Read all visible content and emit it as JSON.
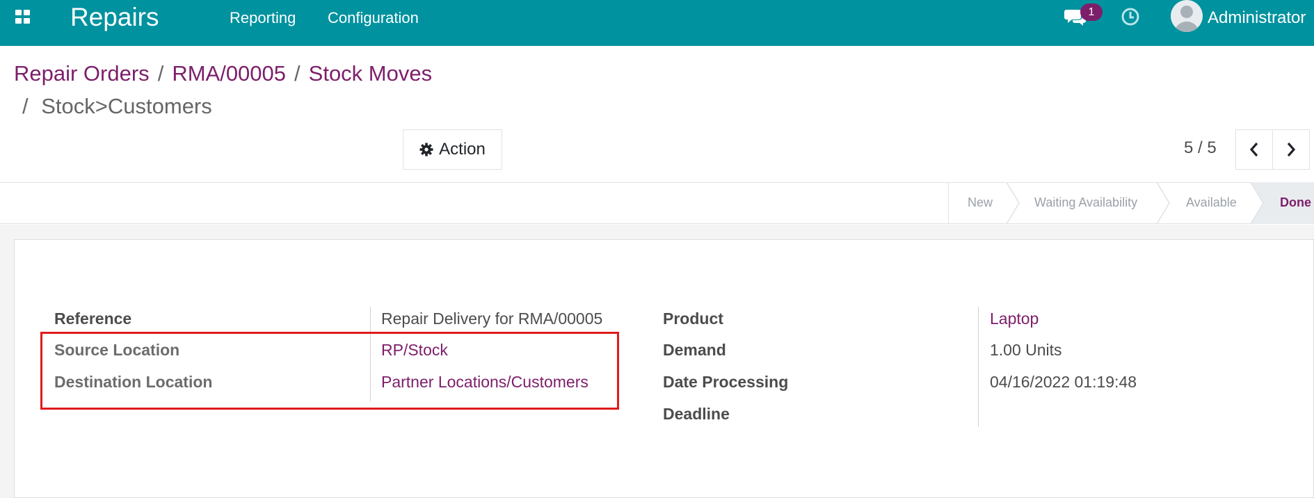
{
  "navbar": {
    "app_title": "Repairs",
    "menu": [
      "Reporting",
      "Configuration"
    ],
    "chat_badge": "1",
    "user_name": "Administrator"
  },
  "breadcrumb": {
    "items": [
      "Repair Orders",
      "RMA/00005",
      "Stock Moves"
    ],
    "separator": "/",
    "current": "Stock>Customers"
  },
  "toolbar": {
    "action_label": "Action",
    "pager": "5 / 5"
  },
  "status": {
    "steps": [
      "New",
      "Waiting Availability",
      "Available",
      "Done"
    ],
    "active": "Done"
  },
  "form": {
    "left": [
      {
        "label": "Reference",
        "value": "Repair Delivery for RMA/00005"
      },
      {
        "label": "Source Location",
        "value": "RP/Stock"
      },
      {
        "label": "Destination Location",
        "value": "Partner Locations/Customers"
      }
    ],
    "right": [
      {
        "label": "Product",
        "value": "Laptop"
      },
      {
        "label": "Demand",
        "value": "1.00 Units"
      },
      {
        "label": "Date Processing",
        "value": "04/16/2022 01:19:48"
      },
      {
        "label": "Deadline",
        "value": ""
      }
    ]
  },
  "colors": {
    "navbar": "#00929f",
    "link": "#7c1e6a",
    "highlight": "#e01b1b"
  },
  "icons": [
    "apps-grid-icon",
    "chat-icon",
    "clock-icon",
    "avatar",
    "gear-icon",
    "chevron-left-icon",
    "chevron-right-icon"
  ]
}
